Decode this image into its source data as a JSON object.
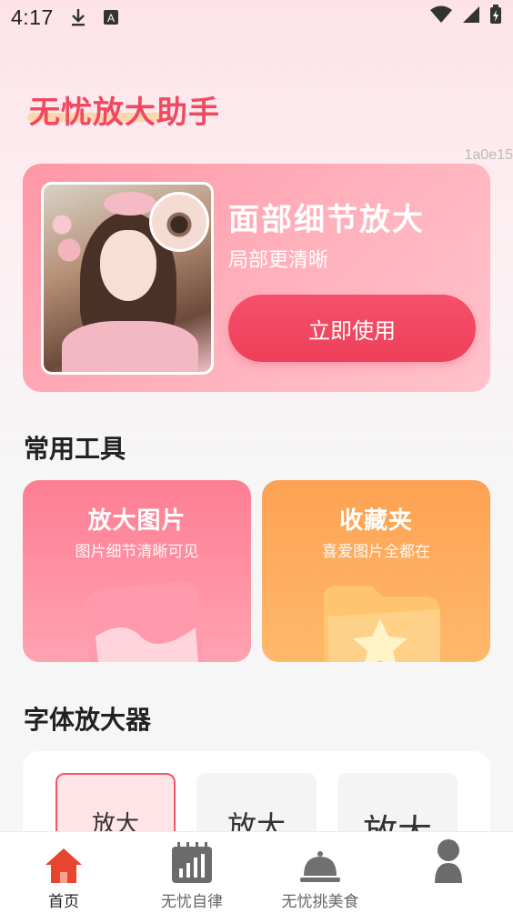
{
  "status_bar": {
    "time": "4:17",
    "icons": [
      "download-icon",
      "a-notification-icon",
      "wifi-icon",
      "signal-icon",
      "battery-icon"
    ]
  },
  "header": {
    "app_title": "无忧放大助手",
    "build_id": "1a0e15"
  },
  "banner": {
    "heading": "面部细节放大",
    "subheading": "局部更清晰",
    "button_label": "立即使用"
  },
  "tools_section": {
    "title": "常用工具",
    "cards": [
      {
        "title": "放大图片",
        "subtitle": "图片细节清晰可见",
        "color": "#fe8597"
      },
      {
        "title": "收藏夹",
        "subtitle": "喜爱图片全都在",
        "color": "#fda95d"
      }
    ]
  },
  "font_section": {
    "title": "字体放大器",
    "options": [
      "放大",
      "放大",
      "放大"
    ],
    "selected_index": 0
  },
  "tab_bar": {
    "tabs": [
      {
        "label": "首页",
        "icon": "home-icon",
        "active": true
      },
      {
        "label": "无忧自律",
        "icon": "calendar-chart-icon",
        "active": false
      },
      {
        "label": "无忧挑美食",
        "icon": "food-cloche-icon",
        "active": false
      },
      {
        "label": "",
        "icon": "profile-icon",
        "active": false
      }
    ]
  },
  "colors": {
    "accent": "#f04a62",
    "button": "#ef3f5a",
    "tab_active": "#e8452e"
  }
}
